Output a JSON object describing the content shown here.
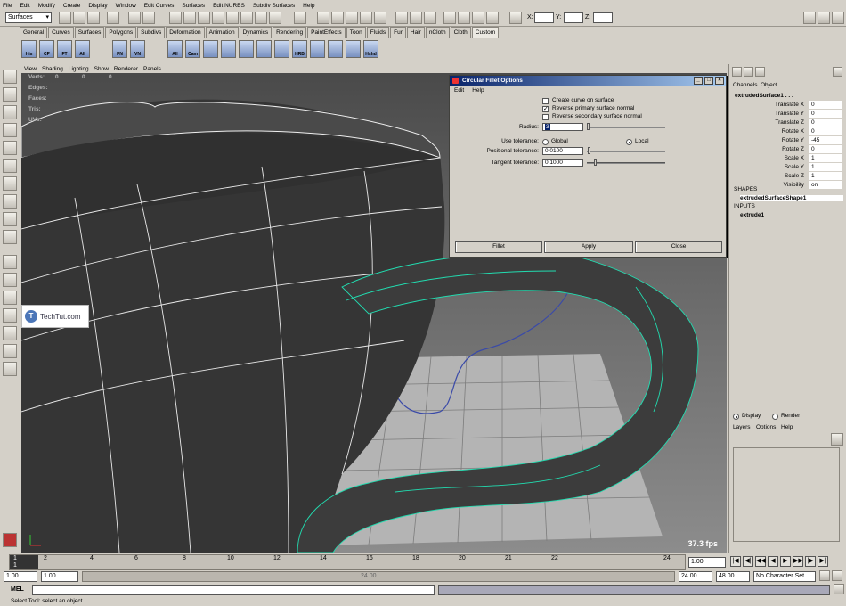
{
  "menubar": {
    "items": [
      "File",
      "Edit",
      "Modify",
      "Create",
      "Display",
      "Window",
      "Edit Curves",
      "Surfaces",
      "Edit NURBS",
      "Subdiv Surfaces",
      "Help"
    ]
  },
  "status_line": {
    "mode_menu": "Surfaces",
    "x_label": "X:",
    "y_label": "Y:",
    "z_label": "Z:"
  },
  "shelf": {
    "tabs": [
      "General",
      "Curves",
      "Surfaces",
      "Polygons",
      "Subdivs",
      "Deformation",
      "Animation",
      "Dynamics",
      "Rendering",
      "PaintEffects",
      "Toon",
      "Fluids",
      "Fur",
      "Hair",
      "nCloth",
      "Cloth",
      "Custom"
    ],
    "active_tab": "Custom",
    "icons": [
      "His",
      "CP",
      "FT",
      "All",
      "FN",
      "VN",
      "All",
      "Cam",
      "",
      "",
      "",
      "",
      "",
      "HRB",
      "",
      "",
      "",
      "Hshd"
    ]
  },
  "viewport": {
    "menu": [
      "View",
      "Shading",
      "Lighting",
      "Show",
      "Renderer",
      "Panels"
    ],
    "hud": [
      "Verts:",
      "Edges:",
      "Faces:",
      "Tris:",
      "UVs:"
    ],
    "hud_values": [
      "0",
      "0",
      "0"
    ],
    "fps": "37.3 fps"
  },
  "watermark": {
    "text": "TechTut.com",
    "letter": "T"
  },
  "dialog": {
    "title": "Circular Fillet Options",
    "menu": [
      "Edit",
      "Help"
    ],
    "checks": [
      {
        "label": "Create curve on surface",
        "checked": false
      },
      {
        "label": "Reverse primary surface normal",
        "checked": true
      },
      {
        "label": "Reverse secondary surface normal",
        "checked": false
      }
    ],
    "radius_label": "Radius:",
    "radius_value": "3",
    "tolerance_label": "Use tolerance:",
    "tolerance_options": [
      "Global",
      "Local"
    ],
    "tolerance_selected": "Local",
    "positional_label": "Positional tolerance:",
    "positional_value": "0.0100",
    "tangent_label": "Tangent tolerance:",
    "tangent_value": "0.1000",
    "buttons": [
      "Fillet",
      "Apply",
      "Close"
    ]
  },
  "channel_box": {
    "tabs": [
      "Channels",
      "Object"
    ],
    "object_name": "extrudedSurface1 . . .",
    "attributes": [
      {
        "name": "Translate X",
        "value": "0"
      },
      {
        "name": "Translate Y",
        "value": "0"
      },
      {
        "name": "Translate Z",
        "value": "0"
      },
      {
        "name": "Rotate X",
        "value": "0"
      },
      {
        "name": "Rotate Y",
        "value": "-45"
      },
      {
        "name": "Rotate Z",
        "value": "0"
      },
      {
        "name": "Scale X",
        "value": "1"
      },
      {
        "name": "Scale Y",
        "value": "1"
      },
      {
        "name": "Scale Z",
        "value": "1"
      },
      {
        "name": "Visibility",
        "value": "on"
      }
    ],
    "shapes_header": "SHAPES",
    "shape_name": "extrudedSurfaceShape1",
    "inputs_header": "INPUTS",
    "input_name": "extrude1"
  },
  "layer_editor": {
    "options": [
      "Display",
      "Render"
    ],
    "selected": "Display",
    "menu": [
      "Layers",
      "Options",
      "Help"
    ]
  },
  "time_slider": {
    "ticks": [
      "1",
      "2",
      "4",
      "6",
      "8",
      "10",
      "12",
      "14",
      "16",
      "18",
      "20",
      "21",
      "22",
      "24"
    ],
    "current_frame": "1",
    "current_time": "1.00"
  },
  "range_slider": {
    "start": "1.00",
    "playback_start": "1.00",
    "center_label": "24.00",
    "playback_end": "24.00",
    "end": "48.00",
    "character_set": "No Character Set"
  },
  "command_line": {
    "label": "MEL"
  },
  "help_line": {
    "text": "Select Tool: select an object"
  }
}
